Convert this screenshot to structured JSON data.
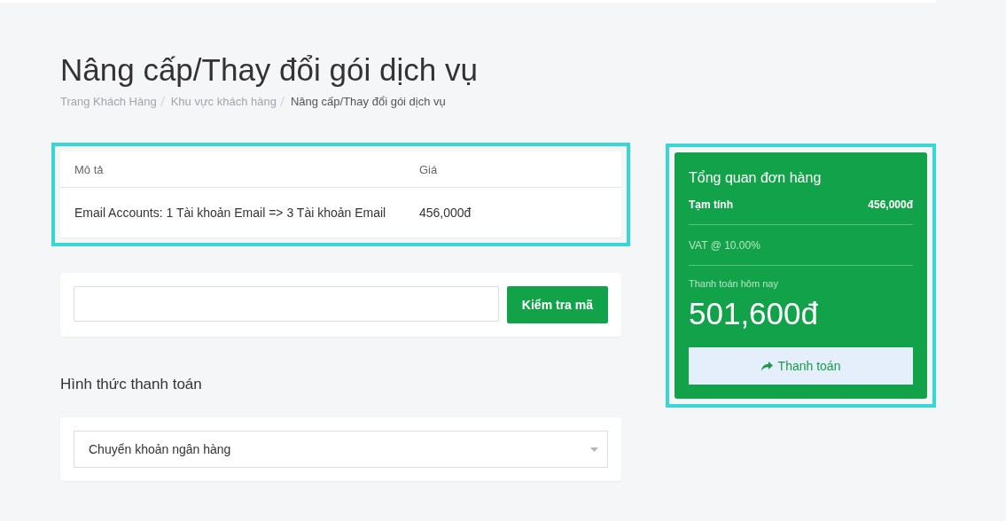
{
  "page_title": "Nâng cấp/Thay đổi gói dịch vụ",
  "breadcrumb": [
    {
      "label": "Trang Khách Hàng",
      "current": false
    },
    {
      "label": "Khu vực khách hàng",
      "current": false
    },
    {
      "label": "Nâng cấp/Thay đổi gói dịch vụ",
      "current": true
    }
  ],
  "items_table": {
    "highlighted": true,
    "columns": [
      "Mô tả",
      "Giá"
    ],
    "rows": [
      [
        "Email Accounts: 1 Tài khoản Email => 3 Tài khoản Email",
        "456,000đ"
      ]
    ]
  },
  "promo": {
    "button": "Kiểm tra mã"
  },
  "payment_method": {
    "heading": "Hình thức thanh toán",
    "value": "Chuyển khoản ngân hàng"
  },
  "summary": {
    "highlighted": true,
    "title": "Tổng quan đơn hàng",
    "lines": [
      {
        "kind": "strong",
        "label": "Tạm tính",
        "value": "456,000đ"
      },
      {
        "kind": "muted",
        "label": "VAT @ 10.00%"
      }
    ],
    "total_label": "Thanh toán hôm nay",
    "total": "501,600đ",
    "button": "Thanh toán"
  }
}
